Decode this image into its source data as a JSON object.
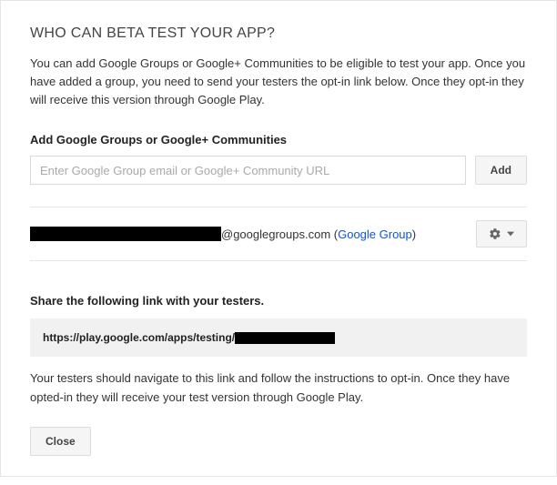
{
  "title": "WHO CAN BETA TEST YOUR APP?",
  "description": "You can add Google Groups or Google+ Communities to be eligible to test your app. Once you have added a group, you need to send your testers the opt-in link below. Once they opt-in they will receive this version through Google Play.",
  "add_section": {
    "label": "Add Google Groups or Google+ Communities",
    "placeholder": "Enter Google Group email or Google+ Community URL",
    "button": "Add"
  },
  "group": {
    "domain_suffix": "@googlegroups.com (",
    "link_text": "Google Group",
    "closing": ")"
  },
  "share": {
    "label": "Share the following link with your testers.",
    "url_prefix": "https://play.google.com/apps/testing/",
    "note": "Your testers should navigate to this link and follow the instructions to opt-in. Once they have opted-in they will receive your test version through Google Play."
  },
  "close_button": "Close"
}
